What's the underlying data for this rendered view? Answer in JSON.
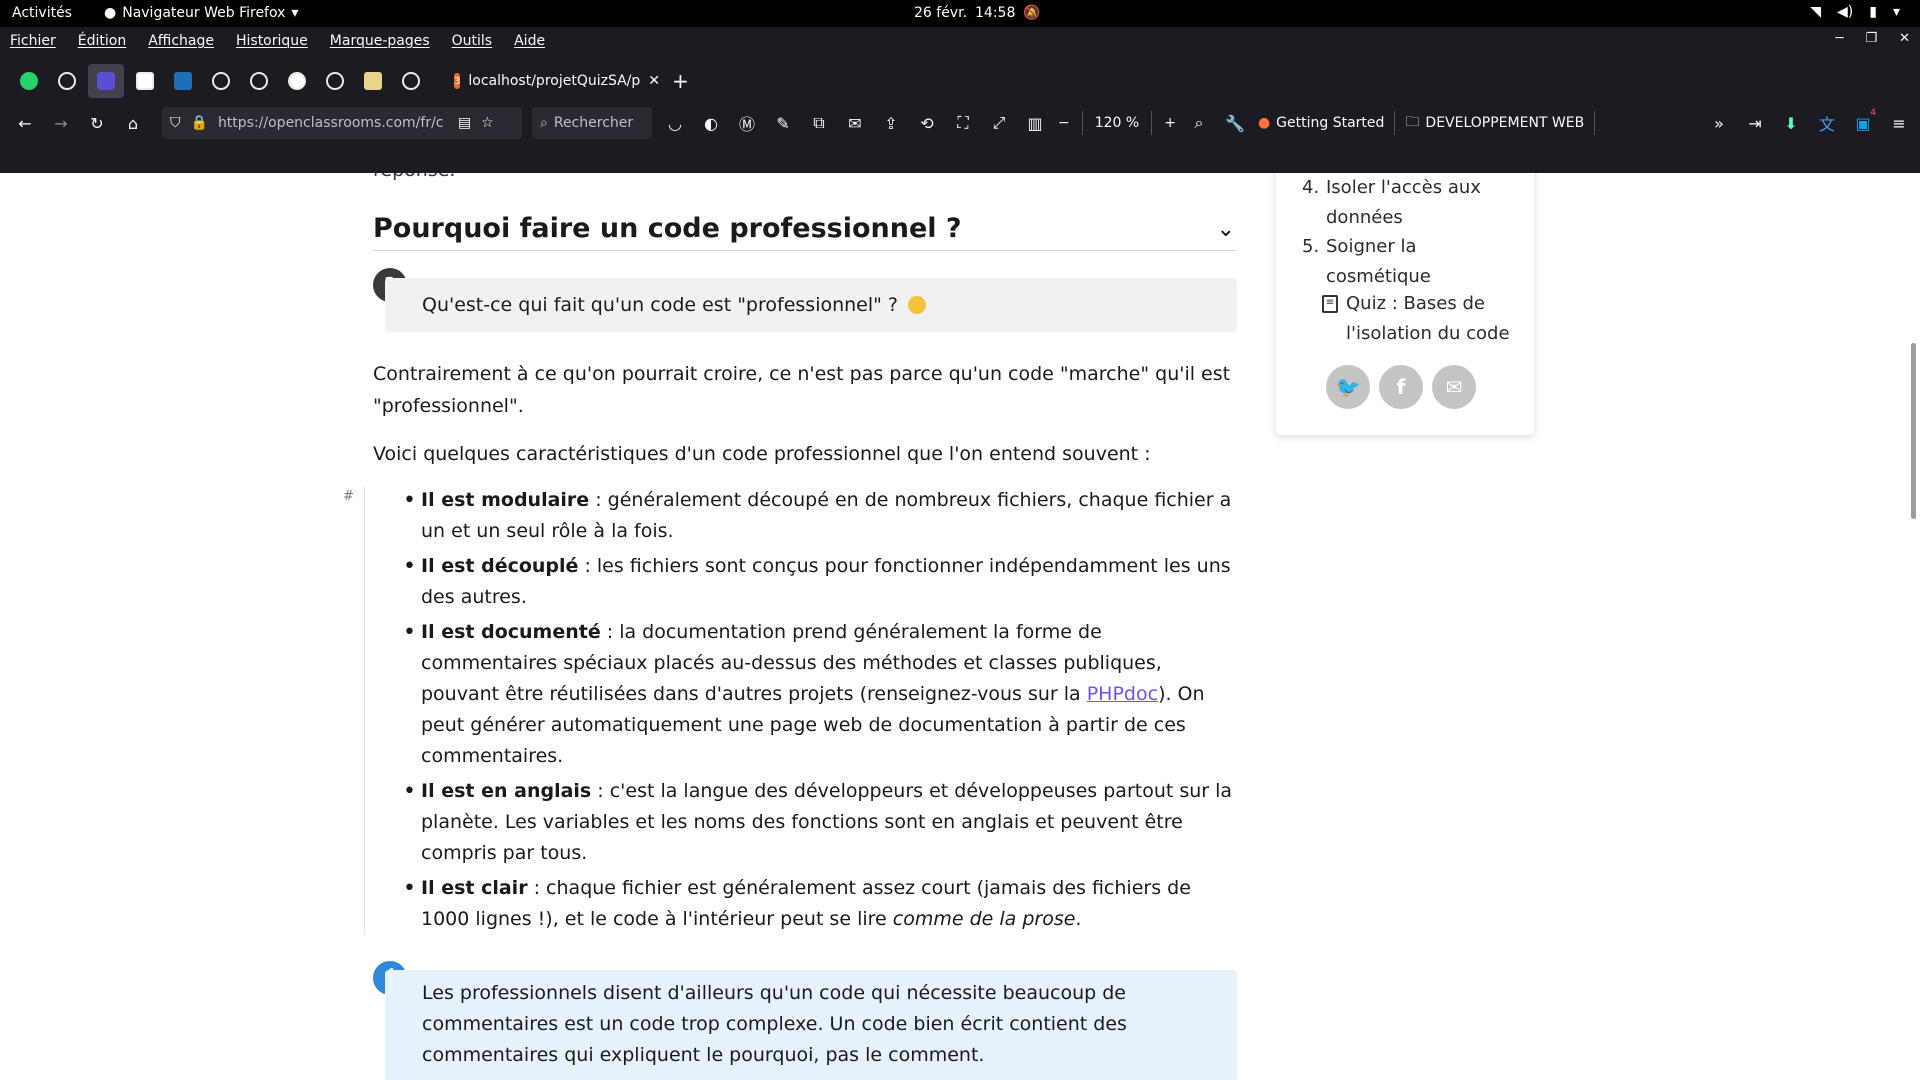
{
  "system_bar": {
    "activities": "Activités",
    "app_name": "Navigateur Web Firefox",
    "date": "26 févr.",
    "time": "14:58"
  },
  "menubar": [
    "Fichier",
    "Édition",
    "Affichage",
    "Historique",
    "Marque-pages",
    "Outils",
    "Aide"
  ],
  "tab": {
    "title": "localhost/projetQuizSA/p",
    "favicon": "3"
  },
  "navbar": {
    "url": "https://openclassrooms.com/fr/c",
    "search_placeholder": "Rechercher",
    "zoom": "120 %",
    "bookmark_getting_started": "Getting Started",
    "bookmark_folder": "DEVELOPPEMENT WEB",
    "notif_count": "4"
  },
  "content": {
    "fragment_top": "réponse.",
    "heading": "Pourquoi faire un code professionnel ?",
    "question_icon": "?",
    "question": "Qu'est-ce qui fait qu'un code est \"professionnel\" ?",
    "para1": "Contrairement à ce qu'on pourrait croire, ce n'est pas parce qu'un code \"marche\" qu'il est \"professionnel\".",
    "para2": "Voici quelques caractéristiques d'un code professionnel que l'on entend souvent :",
    "hash": "#",
    "items": [
      {
        "bold": "Il est modulaire",
        "text": " : généralement découpé en de nombreux fichiers, chaque fichier a un et un seul rôle à la fois."
      },
      {
        "bold": "Il est découplé",
        "text": " : les fichiers sont conçus pour fonctionner indépendamment les uns des autres."
      },
      {
        "bold": "Il est documenté",
        "text": " : la documentation prend généralement la forme de commentaires spéciaux placés au-dessus des méthodes et classes publiques, pouvant être réutilisées dans d'autres projets (renseignez-vous sur la ",
        "link": "PHPdoc",
        "after": "). On peut générer automatiquement une page web de documentation à partir de ces commentaires."
      },
      {
        "bold": "Il est en anglais",
        "text": " : c'est la langue des développeurs et développeuses partout sur la planète. Les variables et les noms des fonctions sont en anglais et peuvent être compris par tous."
      },
      {
        "bold": "Il est clair",
        "text": " : chaque fichier est généralement assez court (jamais des fichiers de 1000 lignes !), et le code à l'intérieur peut se lire ",
        "italic": "comme de la prose",
        "after": "."
      }
    ],
    "info_icon": "i",
    "info": "Les professionnels disent d'ailleurs qu'un code qui nécessite beaucoup de commentaires est un code trop complexe. Un code bien écrit contient des commentaires qui expliquent le pourquoi, pas le comment."
  },
  "sidebar": {
    "toc": [
      {
        "num": "4.",
        "text": "Isoler l'accès aux données"
      },
      {
        "num": "5.",
        "text": "Soigner la cosmétique"
      }
    ],
    "quiz": "Quiz : Bases de l'isolation du code",
    "social": [
      "twitter-icon",
      "facebook-icon",
      "mail-icon"
    ]
  }
}
